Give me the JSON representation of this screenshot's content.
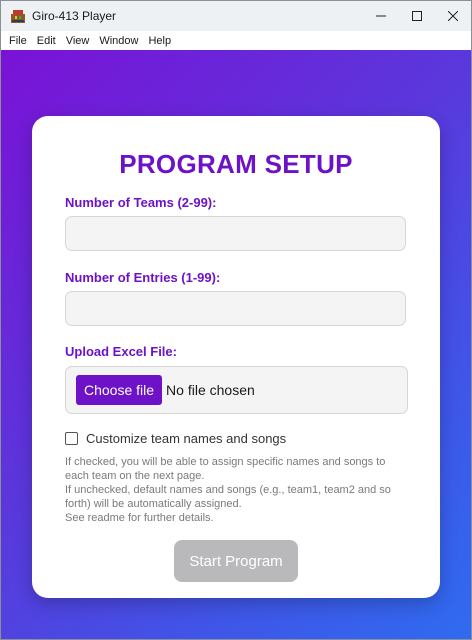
{
  "window": {
    "title": "Giro-413 Player",
    "controls": [
      "minimize-icon",
      "maximize-icon",
      "close-icon"
    ]
  },
  "menubar": {
    "items": [
      {
        "label": "File"
      },
      {
        "label": "Edit"
      },
      {
        "label": "View"
      },
      {
        "label": "Window"
      },
      {
        "label": "Help"
      }
    ]
  },
  "setup": {
    "title": "PROGRAM SETUP",
    "teams": {
      "label": "Number of Teams (2-99):",
      "value": ""
    },
    "entries": {
      "label": "Number of Entries (1-99):",
      "value": ""
    },
    "upload": {
      "label": "Upload Excel File:",
      "button_label": "Choose file",
      "status": "No file chosen"
    },
    "customize": {
      "label": "Customize team names and songs",
      "checked": false
    },
    "help_lines": [
      "If checked, you will be able to assign specific names and songs to",
      "each team on the next page.",
      "If unchecked, default names and songs (e.g., team1, team2 and so",
      "forth) will be automatically assigned.",
      "See readme for further details."
    ],
    "start_label": "Start Program"
  },
  "colors": {
    "accent": "#6d12c6",
    "gradient_start": "#7a12d6",
    "gradient_end": "#2f6bf0",
    "disabled_button": "#b9b9bb"
  }
}
